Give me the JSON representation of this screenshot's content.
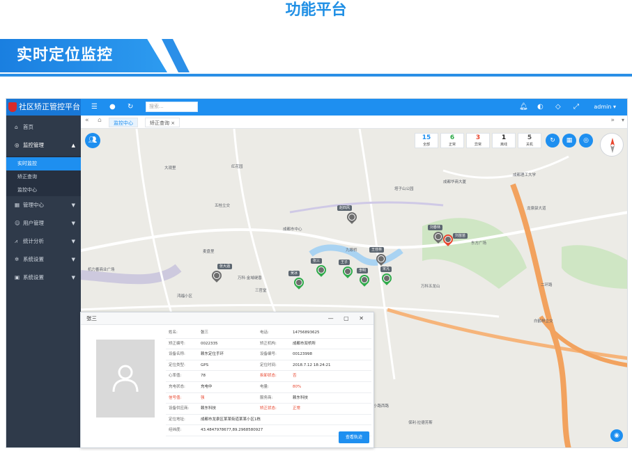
{
  "page": {
    "title": "功能平台",
    "section_title": "实时定位监控"
  },
  "app": {
    "logo_text": "社区矫正管控平台",
    "search_placeholder": "搜索...",
    "user": "admin ▾",
    "colors": {
      "primary": "#1e8ff0",
      "sidebar": "#2f3a4a",
      "sidebar_active": "#1e8ff0",
      "alert": "#e8462e"
    }
  },
  "sidebar": {
    "items": [
      {
        "label": "首页",
        "icon": "home-icon"
      },
      {
        "label": "监控管理",
        "icon": "monitor-icon",
        "expanded": true
      },
      {
        "label": "管理中心",
        "icon": "grid-icon"
      },
      {
        "label": "用户管理",
        "icon": "user-icon"
      },
      {
        "label": "统计分析",
        "icon": "chart-icon"
      },
      {
        "label": "系统设置",
        "icon": "gear-icon"
      },
      {
        "label": "系统设置",
        "icon": "settings-icon"
      }
    ],
    "submenu": [
      {
        "label": "实时监控",
        "active": true
      },
      {
        "label": "矫正查询"
      },
      {
        "label": "监控中心"
      }
    ]
  },
  "tabs": [
    {
      "label": "监控中心",
      "active": true
    },
    {
      "label": "矫正查询 ×"
    }
  ],
  "stats": [
    {
      "value": "15",
      "label": "全部",
      "color": "#1e8ff0"
    },
    {
      "value": "6",
      "label": "正常",
      "color": "#2eaa4a"
    },
    {
      "value": "3",
      "label": "异常",
      "color": "#e8462e"
    },
    {
      "value": "1",
      "label": "离线",
      "color": "#222222"
    },
    {
      "value": "5",
      "label": "关机",
      "color": "#555555"
    }
  ],
  "map": {
    "labels": [
      "大观里",
      "五桂立交",
      "塔子山公园",
      "成都市中心",
      "九眼桥",
      "三官堂",
      "万科五龙山",
      "白鹤林立交",
      "机力番商业广场",
      "麦盘里",
      "红花园",
      "鸿福小区",
      "成都华商大厦",
      "二环路",
      "龙泉驿大道",
      "成都理工大学",
      "东方广场",
      "保利·拉德芳斯",
      "小路西路",
      "万科·金域缇香"
    ],
    "pins": [
      {
        "name": "张大涵"
      },
      {
        "name": "赵四风"
      },
      {
        "name": "刘春林"
      },
      {
        "name": "王佳林"
      },
      {
        "name": "刘苗苗"
      },
      {
        "name": "王子"
      },
      {
        "name": "李明"
      },
      {
        "name": "宋凡"
      },
      {
        "name": "吴冰"
      },
      {
        "name": "张三"
      }
    ]
  },
  "popup": {
    "title": "张三",
    "controls": "— ▢ ✕",
    "rows": [
      {
        "k1": "姓名:",
        "v1": "张三",
        "k2": "电话:",
        "v2": "14756893625"
      },
      {
        "k1": "矫正编号:",
        "v1": "0022335",
        "k2": "矫正机构:",
        "v2": "成都市双桥所"
      },
      {
        "k1": "设备名称:",
        "v1": "赖东定位手环",
        "k2": "设备编号:",
        "v2": "00123998"
      },
      {
        "k1": "定位类型:",
        "v1": "GPS",
        "k2": "定位时间:",
        "v2": "2018.7.12 18:24:21"
      },
      {
        "k1": "心率值:",
        "v1": "78",
        "k2": "拆卸状态:",
        "v2": "否",
        "k2_red": true,
        "v2_red": true
      },
      {
        "k1": "充电状态:",
        "v1": "充电中",
        "k2": "电量:",
        "v2": "80%",
        "v2_red": true
      },
      {
        "k1": "信号值:",
        "v1": "强",
        "k2": "服务商:",
        "v2": "赖东科技",
        "k1_red": true,
        "v1_red": true
      },
      {
        "k1": "设备供应商:",
        "v1": "赖东科技",
        "k2": "矫正状态:",
        "v2": "正常",
        "k2_red": true,
        "v2_red": true
      },
      {
        "k1": "定位地址:",
        "v1": "成都市龙泉区某某街道某某小区1栋"
      },
      {
        "k1": "经纬度:",
        "v1": "43.4847978677,89.2968580927"
      }
    ],
    "track_button": "查看轨迹"
  }
}
